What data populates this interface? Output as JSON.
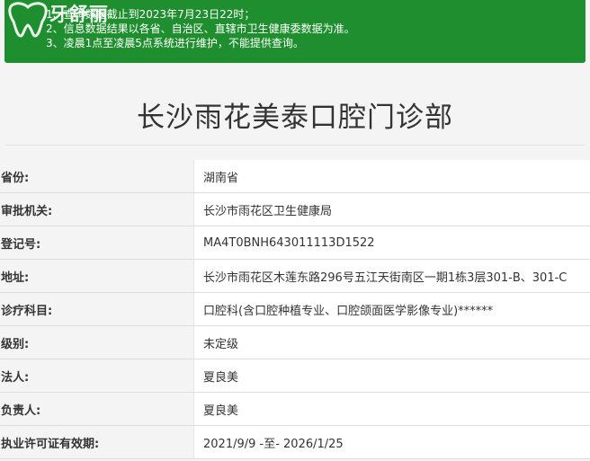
{
  "notice": {
    "lines": [
      "1、查询数据截止到2023年7月23日22时；",
      "2、信息数据结果以各省、自治区、直辖市卫生健康委数据为准。",
      "3、凌晨1点至凌晨5点系统进行维护，不能提供查询。"
    ],
    "logo_text": "牙舒丽",
    "background_color": "#1e8e2e"
  },
  "title": "长沙雨花美泰口腔门诊部",
  "rows": [
    {
      "label": "省份:",
      "value": "湖南省"
    },
    {
      "label": "审批机关:",
      "value": "长沙市雨花区卫生健康局"
    },
    {
      "label": "登记号:",
      "value": "MA4T0BNH643011113D1522"
    },
    {
      "label": "地址:",
      "value": "长沙市雨花区木莲东路296号五江天街南区一期1栋3层301-B、301-C"
    },
    {
      "label": "诊疗科目:",
      "value": "口腔科(含口腔种植专业、口腔颌面医学影像专业)******"
    },
    {
      "label": "级别:",
      "value": "未定级"
    },
    {
      "label": "法人:",
      "value": "夏良美"
    },
    {
      "label": "负责人:",
      "value": "夏良美"
    },
    {
      "label": "执业许可证有效期:",
      "value": "2021/9/9 -至- 2026/1/25"
    }
  ]
}
